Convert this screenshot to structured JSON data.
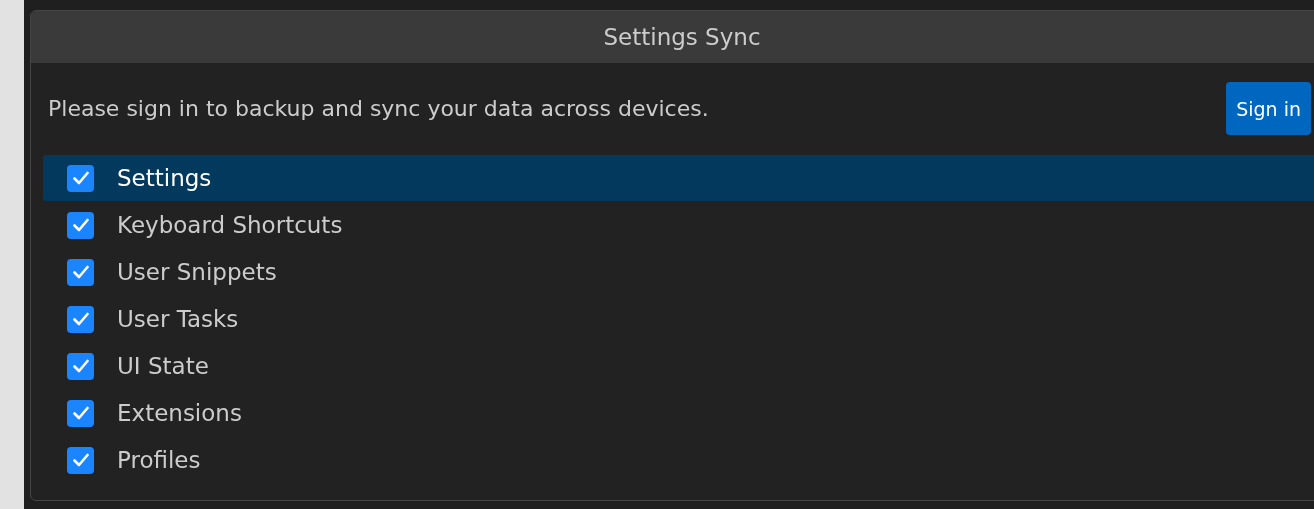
{
  "dialog": {
    "title": "Settings Sync",
    "message": "Please sign in to backup and sync your data across devices.",
    "button": "Sign in"
  },
  "items": [
    {
      "label": "Settings",
      "checked": true,
      "selected": true
    },
    {
      "label": "Keyboard Shortcuts",
      "checked": true,
      "selected": false
    },
    {
      "label": "User Snippets",
      "checked": true,
      "selected": false
    },
    {
      "label": "User Tasks",
      "checked": true,
      "selected": false
    },
    {
      "label": "UI State",
      "checked": true,
      "selected": false
    },
    {
      "label": "Extensions",
      "checked": true,
      "selected": false
    },
    {
      "label": "Profiles",
      "checked": true,
      "selected": false
    }
  ]
}
